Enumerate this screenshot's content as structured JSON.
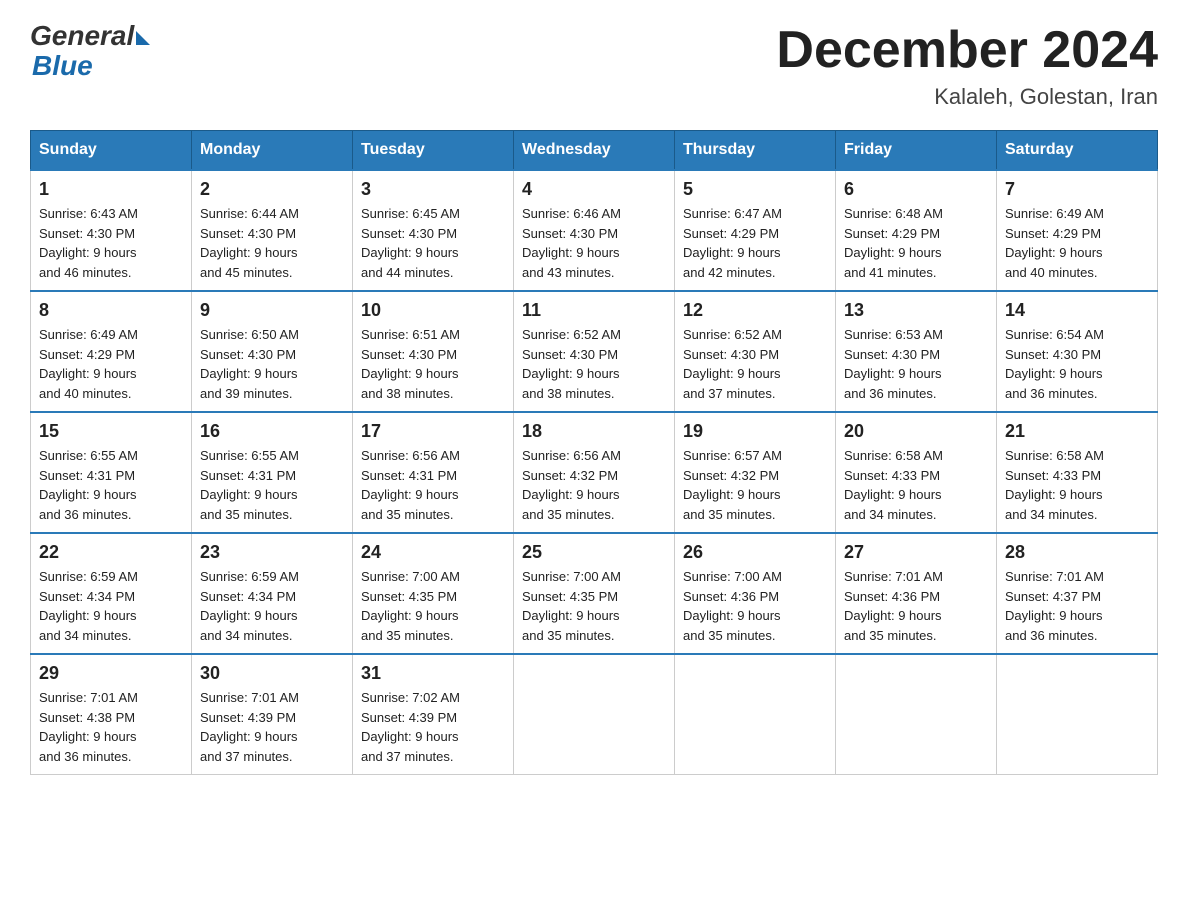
{
  "header": {
    "logo_general": "General",
    "logo_blue": "Blue",
    "title": "December 2024",
    "location": "Kalaleh, Golestan, Iran"
  },
  "weekdays": [
    "Sunday",
    "Monday",
    "Tuesday",
    "Wednesday",
    "Thursday",
    "Friday",
    "Saturday"
  ],
  "weeks": [
    [
      {
        "day": "1",
        "sunrise": "6:43 AM",
        "sunset": "4:30 PM",
        "daylight": "9 hours and 46 minutes."
      },
      {
        "day": "2",
        "sunrise": "6:44 AM",
        "sunset": "4:30 PM",
        "daylight": "9 hours and 45 minutes."
      },
      {
        "day": "3",
        "sunrise": "6:45 AM",
        "sunset": "4:30 PM",
        "daylight": "9 hours and 44 minutes."
      },
      {
        "day": "4",
        "sunrise": "6:46 AM",
        "sunset": "4:30 PM",
        "daylight": "9 hours and 43 minutes."
      },
      {
        "day": "5",
        "sunrise": "6:47 AM",
        "sunset": "4:29 PM",
        "daylight": "9 hours and 42 minutes."
      },
      {
        "day": "6",
        "sunrise": "6:48 AM",
        "sunset": "4:29 PM",
        "daylight": "9 hours and 41 minutes."
      },
      {
        "day": "7",
        "sunrise": "6:49 AM",
        "sunset": "4:29 PM",
        "daylight": "9 hours and 40 minutes."
      }
    ],
    [
      {
        "day": "8",
        "sunrise": "6:49 AM",
        "sunset": "4:29 PM",
        "daylight": "9 hours and 40 minutes."
      },
      {
        "day": "9",
        "sunrise": "6:50 AM",
        "sunset": "4:30 PM",
        "daylight": "9 hours and 39 minutes."
      },
      {
        "day": "10",
        "sunrise": "6:51 AM",
        "sunset": "4:30 PM",
        "daylight": "9 hours and 38 minutes."
      },
      {
        "day": "11",
        "sunrise": "6:52 AM",
        "sunset": "4:30 PM",
        "daylight": "9 hours and 38 minutes."
      },
      {
        "day": "12",
        "sunrise": "6:52 AM",
        "sunset": "4:30 PM",
        "daylight": "9 hours and 37 minutes."
      },
      {
        "day": "13",
        "sunrise": "6:53 AM",
        "sunset": "4:30 PM",
        "daylight": "9 hours and 36 minutes."
      },
      {
        "day": "14",
        "sunrise": "6:54 AM",
        "sunset": "4:30 PM",
        "daylight": "9 hours and 36 minutes."
      }
    ],
    [
      {
        "day": "15",
        "sunrise": "6:55 AM",
        "sunset": "4:31 PM",
        "daylight": "9 hours and 36 minutes."
      },
      {
        "day": "16",
        "sunrise": "6:55 AM",
        "sunset": "4:31 PM",
        "daylight": "9 hours and 35 minutes."
      },
      {
        "day": "17",
        "sunrise": "6:56 AM",
        "sunset": "4:31 PM",
        "daylight": "9 hours and 35 minutes."
      },
      {
        "day": "18",
        "sunrise": "6:56 AM",
        "sunset": "4:32 PM",
        "daylight": "9 hours and 35 minutes."
      },
      {
        "day": "19",
        "sunrise": "6:57 AM",
        "sunset": "4:32 PM",
        "daylight": "9 hours and 35 minutes."
      },
      {
        "day": "20",
        "sunrise": "6:58 AM",
        "sunset": "4:33 PM",
        "daylight": "9 hours and 34 minutes."
      },
      {
        "day": "21",
        "sunrise": "6:58 AM",
        "sunset": "4:33 PM",
        "daylight": "9 hours and 34 minutes."
      }
    ],
    [
      {
        "day": "22",
        "sunrise": "6:59 AM",
        "sunset": "4:34 PM",
        "daylight": "9 hours and 34 minutes."
      },
      {
        "day": "23",
        "sunrise": "6:59 AM",
        "sunset": "4:34 PM",
        "daylight": "9 hours and 34 minutes."
      },
      {
        "day": "24",
        "sunrise": "7:00 AM",
        "sunset": "4:35 PM",
        "daylight": "9 hours and 35 minutes."
      },
      {
        "day": "25",
        "sunrise": "7:00 AM",
        "sunset": "4:35 PM",
        "daylight": "9 hours and 35 minutes."
      },
      {
        "day": "26",
        "sunrise": "7:00 AM",
        "sunset": "4:36 PM",
        "daylight": "9 hours and 35 minutes."
      },
      {
        "day": "27",
        "sunrise": "7:01 AM",
        "sunset": "4:36 PM",
        "daylight": "9 hours and 35 minutes."
      },
      {
        "day": "28",
        "sunrise": "7:01 AM",
        "sunset": "4:37 PM",
        "daylight": "9 hours and 36 minutes."
      }
    ],
    [
      {
        "day": "29",
        "sunrise": "7:01 AM",
        "sunset": "4:38 PM",
        "daylight": "9 hours and 36 minutes."
      },
      {
        "day": "30",
        "sunrise": "7:01 AM",
        "sunset": "4:39 PM",
        "daylight": "9 hours and 37 minutes."
      },
      {
        "day": "31",
        "sunrise": "7:02 AM",
        "sunset": "4:39 PM",
        "daylight": "9 hours and 37 minutes."
      },
      null,
      null,
      null,
      null
    ]
  ]
}
